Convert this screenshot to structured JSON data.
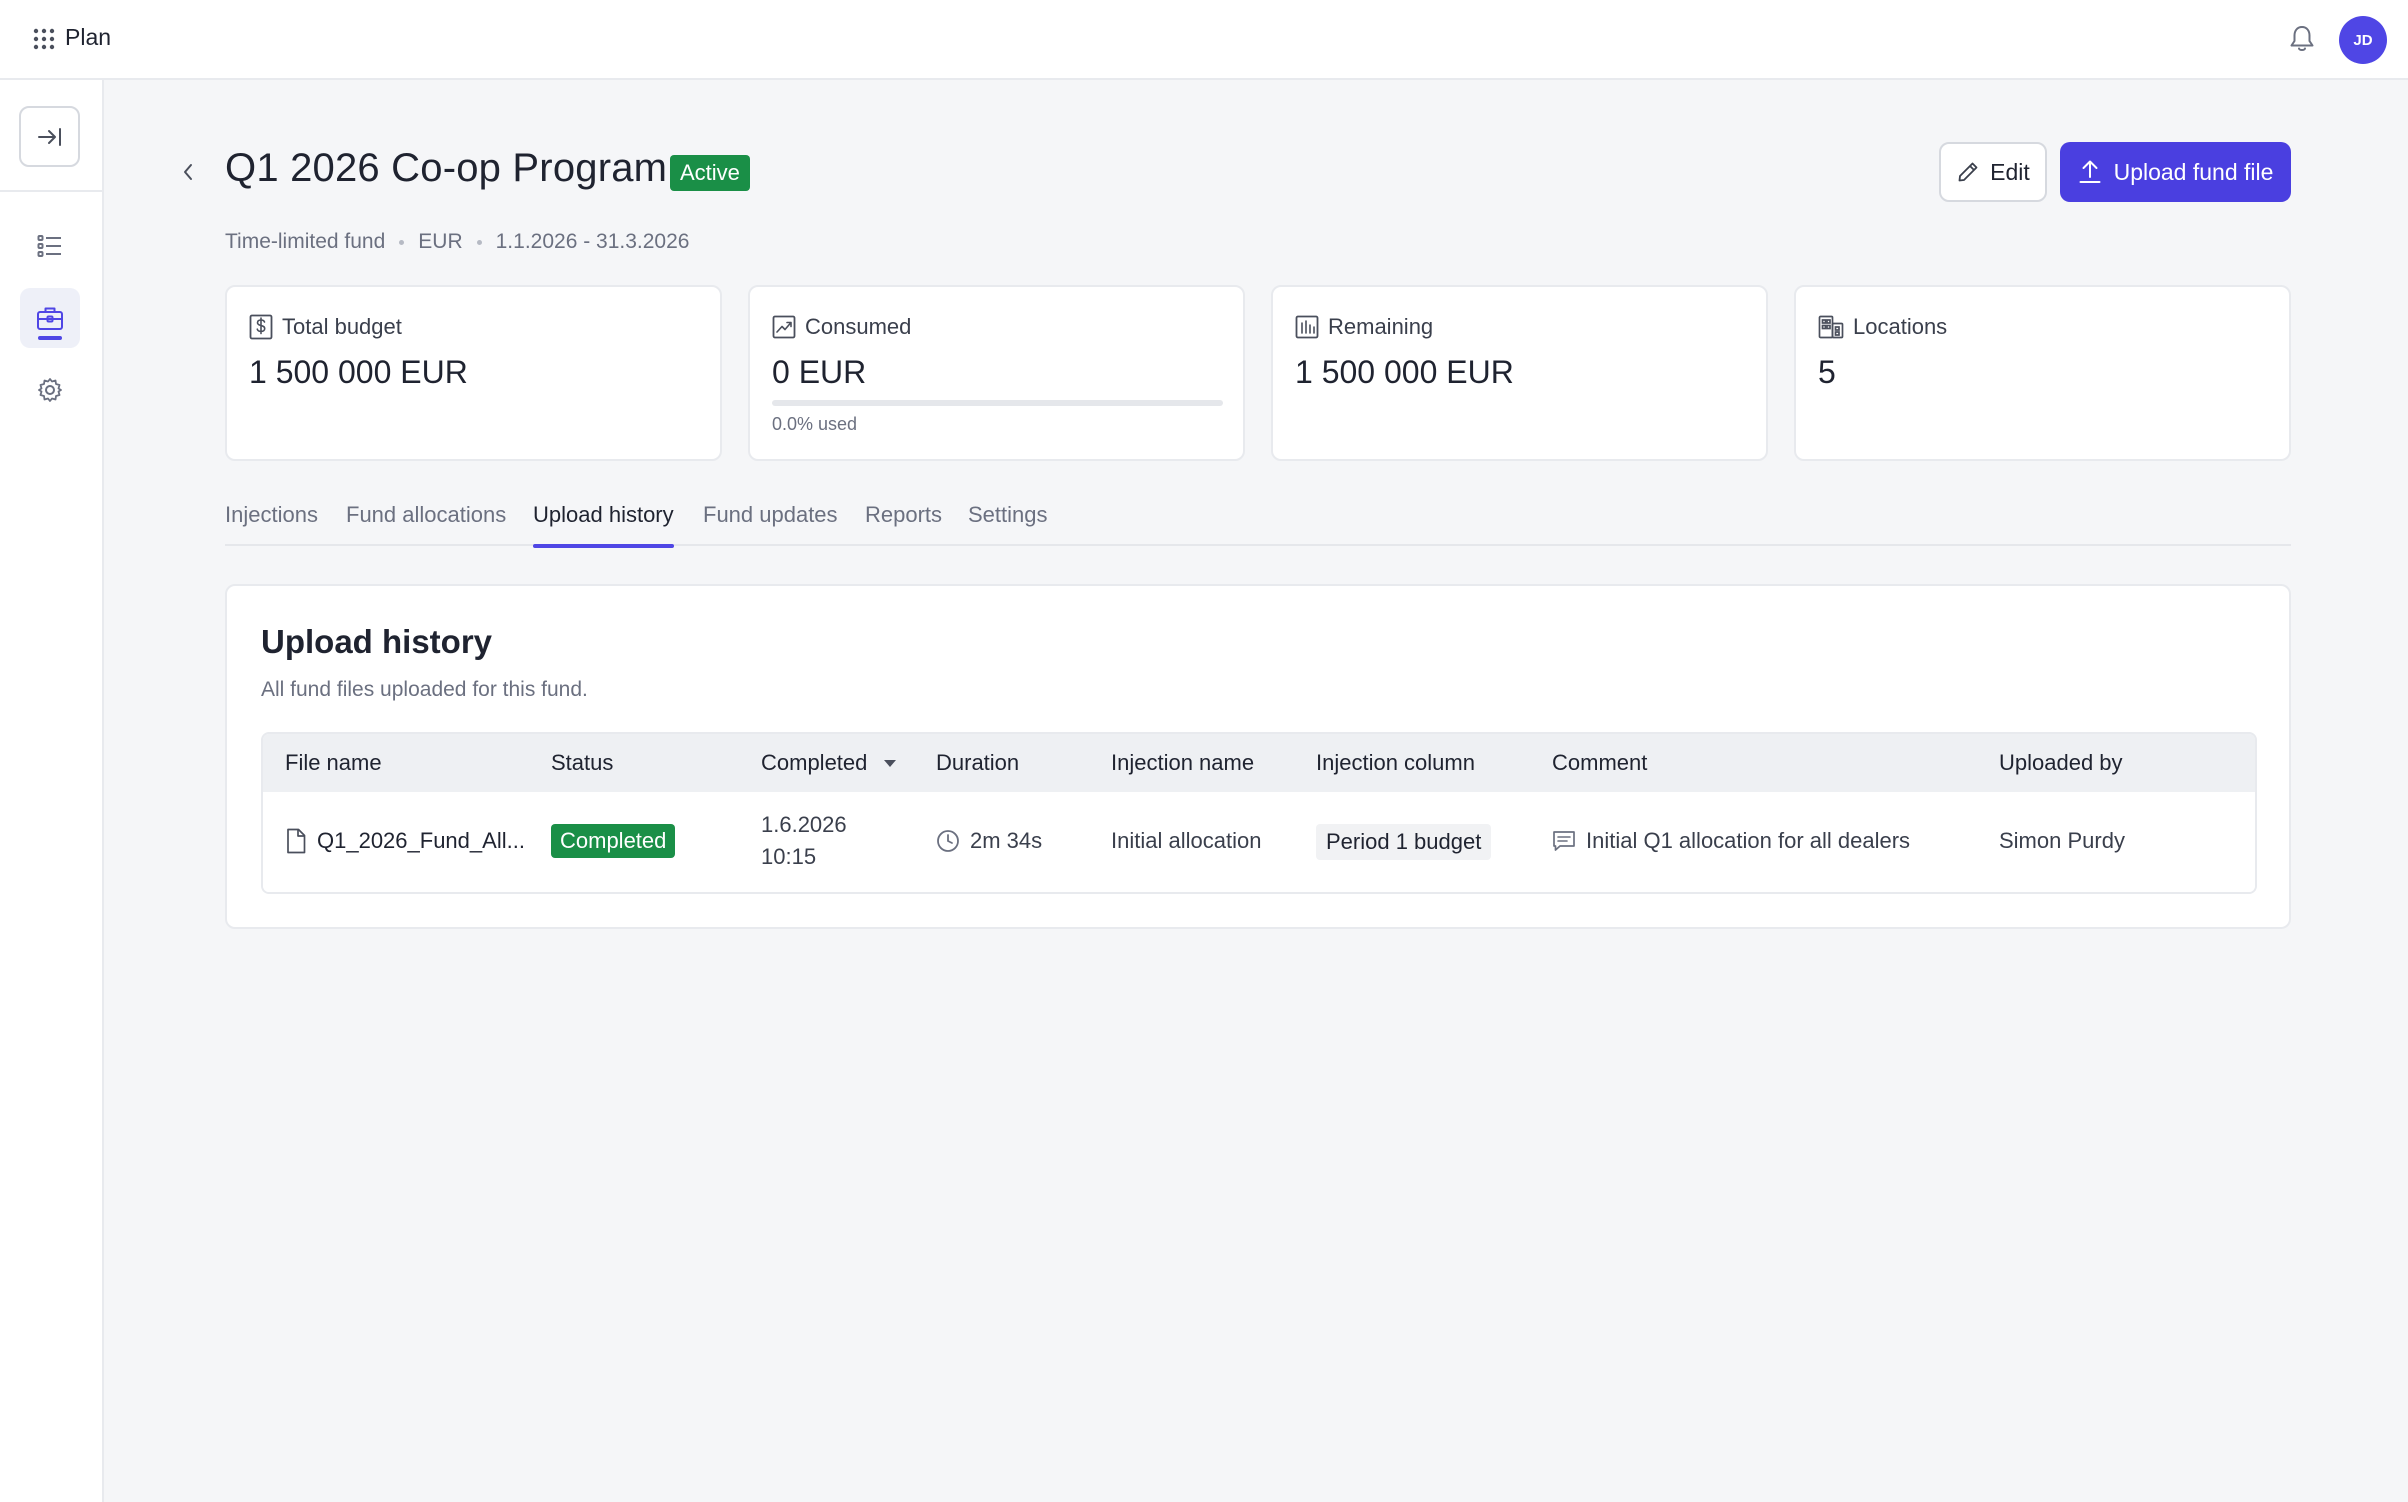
{
  "app": {
    "name": "Plan",
    "user_initials": "JD"
  },
  "header": {
    "title": "Q1 2026 Co-op Program",
    "status": "Active",
    "edit_label": "Edit",
    "upload_label": "Upload fund file",
    "meta": [
      "Time-limited fund",
      "EUR",
      "1.1.2026 - 31.3.2026"
    ]
  },
  "stats": [
    {
      "label": "Total budget",
      "value": "1 500 000 EUR",
      "icon": "dollar-icon"
    },
    {
      "label": "Consumed",
      "value": "0 EUR",
      "icon": "trend-icon",
      "progress_fraction": 0.0,
      "progress_text": "0.0% used"
    },
    {
      "label": "Remaining",
      "value": "1 500 000 EUR",
      "icon": "bar-chart-icon"
    },
    {
      "label": "Locations",
      "value": "5",
      "icon": "building-icon"
    }
  ],
  "tabs": [
    {
      "label": "Injections"
    },
    {
      "label": "Fund allocations"
    },
    {
      "label": "Upload history",
      "active": true
    },
    {
      "label": "Fund updates"
    },
    {
      "label": "Reports"
    },
    {
      "label": "Settings"
    }
  ],
  "panel": {
    "title": "Upload history",
    "subtitle": "All fund files uploaded for this fund.",
    "columns": [
      "File name",
      "Status",
      "Completed",
      "Duration",
      "Injection name",
      "Injection column",
      "Comment",
      "Uploaded by"
    ],
    "rows": [
      {
        "file_name": "Q1_2026_Fund_All...",
        "status": "Completed",
        "completed_date": "1.6.2026",
        "completed_time": "10:15",
        "duration": "2m 34s",
        "injection_name": "Initial allocation",
        "injection_column": "Period 1 budget",
        "comment": "Initial Q1 allocation for all dealers",
        "uploaded_by": "Simon Purdy"
      }
    ]
  },
  "colors": {
    "accent": "#4a3fe0",
    "success": "#1a8f47"
  }
}
